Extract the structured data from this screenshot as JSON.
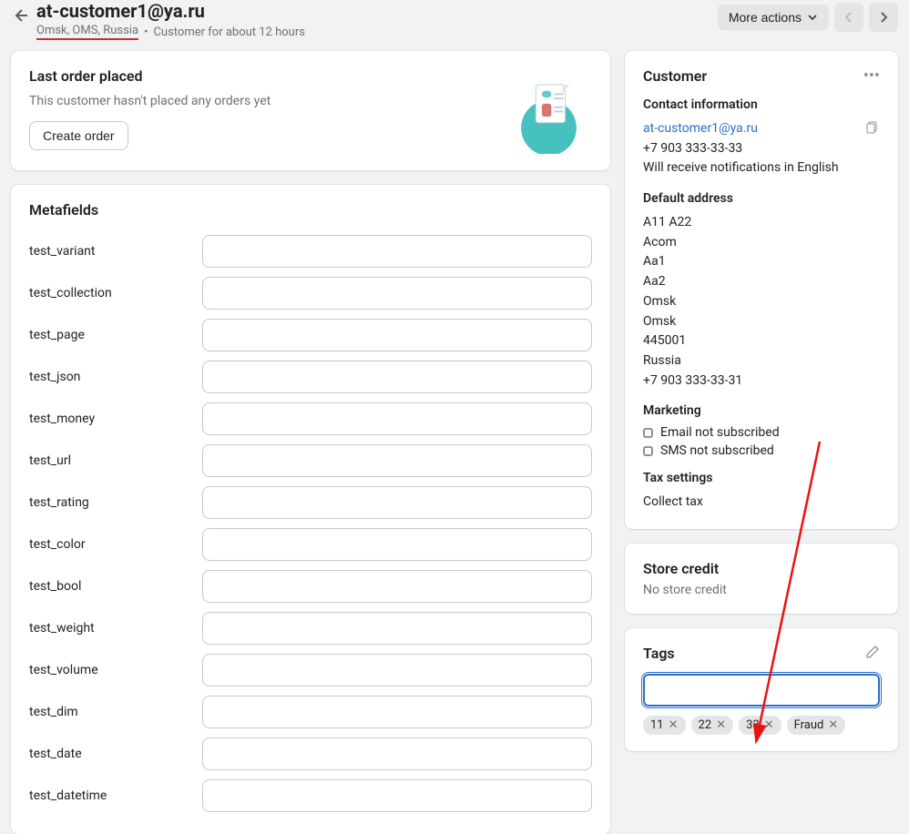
{
  "header": {
    "title": "at-customer1@ya.ru",
    "location": "Omsk, OMS, Russia",
    "customer_for": "Customer for about 12 hours",
    "more_actions_label": "More actions"
  },
  "order": {
    "heading": "Last order placed",
    "empty_text": "This customer hasn't placed any orders yet",
    "create_label": "Create order"
  },
  "metafields": {
    "heading": "Metafields",
    "fields": [
      {
        "label": "test_variant",
        "value": ""
      },
      {
        "label": "test_collection",
        "value": ""
      },
      {
        "label": "test_page",
        "value": ""
      },
      {
        "label": "test_json",
        "value": ""
      },
      {
        "label": "test_money",
        "value": ""
      },
      {
        "label": "test_url",
        "value": ""
      },
      {
        "label": "test_rating",
        "value": ""
      },
      {
        "label": "test_color",
        "value": ""
      },
      {
        "label": "test_bool",
        "value": ""
      },
      {
        "label": "test_weight",
        "value": ""
      },
      {
        "label": "test_volume",
        "value": ""
      },
      {
        "label": "test_dim",
        "value": ""
      },
      {
        "label": "test_date",
        "value": ""
      },
      {
        "label": "test_datetime",
        "value": ""
      }
    ]
  },
  "customer": {
    "heading": "Customer",
    "contact_heading": "Contact information",
    "email": "at-customer1@ya.ru",
    "phone": "+7 903 333-33-33",
    "notif_lang": "Will receive notifications in English",
    "address_heading": "Default address",
    "address_lines": [
      "A11 A22",
      "Acom",
      "Aa1",
      "Aa2",
      "Omsk",
      "Omsk",
      "445001",
      "Russia",
      "+7 903 333-33-31"
    ],
    "marketing_heading": "Marketing",
    "marketing": [
      "Email not subscribed",
      "SMS not subscribed"
    ],
    "tax_heading": "Tax settings",
    "tax_line": "Collect tax"
  },
  "store_credit": {
    "heading": "Store credit",
    "text": "No store credit"
  },
  "tags": {
    "heading": "Tags",
    "input_value": "",
    "items": [
      "11",
      "22",
      "33",
      "Fraud"
    ]
  }
}
